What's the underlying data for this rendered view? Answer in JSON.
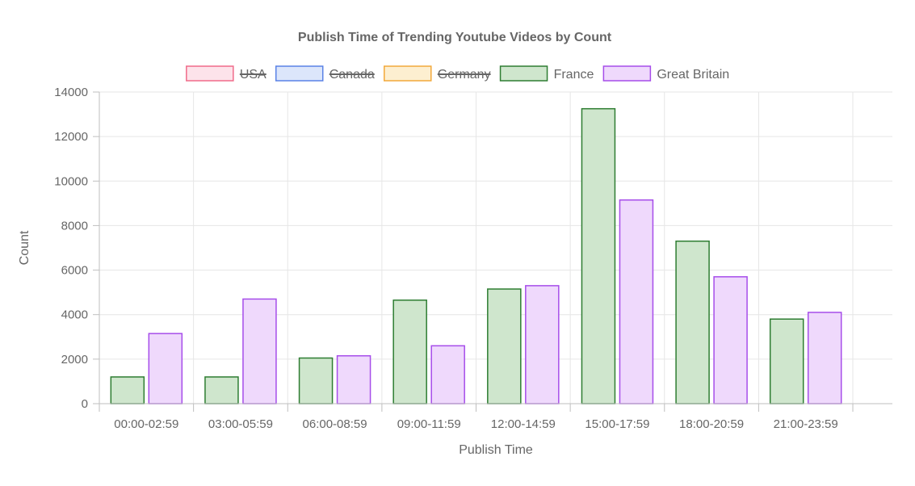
{
  "chart_data": {
    "type": "bar",
    "title": "Publish Time of Trending Youtube Videos by Count",
    "xlabel": "Publish Time",
    "ylabel": "Count",
    "ylim": [
      0,
      14000
    ],
    "yticks": [
      0,
      2000,
      4000,
      6000,
      8000,
      10000,
      12000,
      14000
    ],
    "grid": true,
    "legend_position": "top",
    "categories": [
      "00:00-02:59",
      "03:00-05:59",
      "06:00-08:59",
      "09:00-11:59",
      "12:00-14:59",
      "15:00-17:59",
      "18:00-20:59",
      "21:00-23:59"
    ],
    "series": [
      {
        "name": "USA",
        "hidden": true,
        "fill": "#fde3ea",
        "border": "#f06b8a",
        "values": []
      },
      {
        "name": "Canada",
        "hidden": true,
        "fill": "#dce6fb",
        "border": "#5a82e6",
        "values": []
      },
      {
        "name": "Germany",
        "hidden": true,
        "fill": "#fdefd0",
        "border": "#f2a93b",
        "values": []
      },
      {
        "name": "France",
        "hidden": false,
        "fill": "#cfe6cd",
        "border": "#2e7d32",
        "values": [
          1200,
          1200,
          2050,
          4650,
          5150,
          13250,
          7300,
          3800
        ]
      },
      {
        "name": "Great Britain",
        "hidden": false,
        "fill": "#efd9fc",
        "border": "#a64dea",
        "values": [
          3150,
          4700,
          2150,
          2600,
          5300,
          9150,
          5700,
          4100
        ]
      }
    ]
  }
}
